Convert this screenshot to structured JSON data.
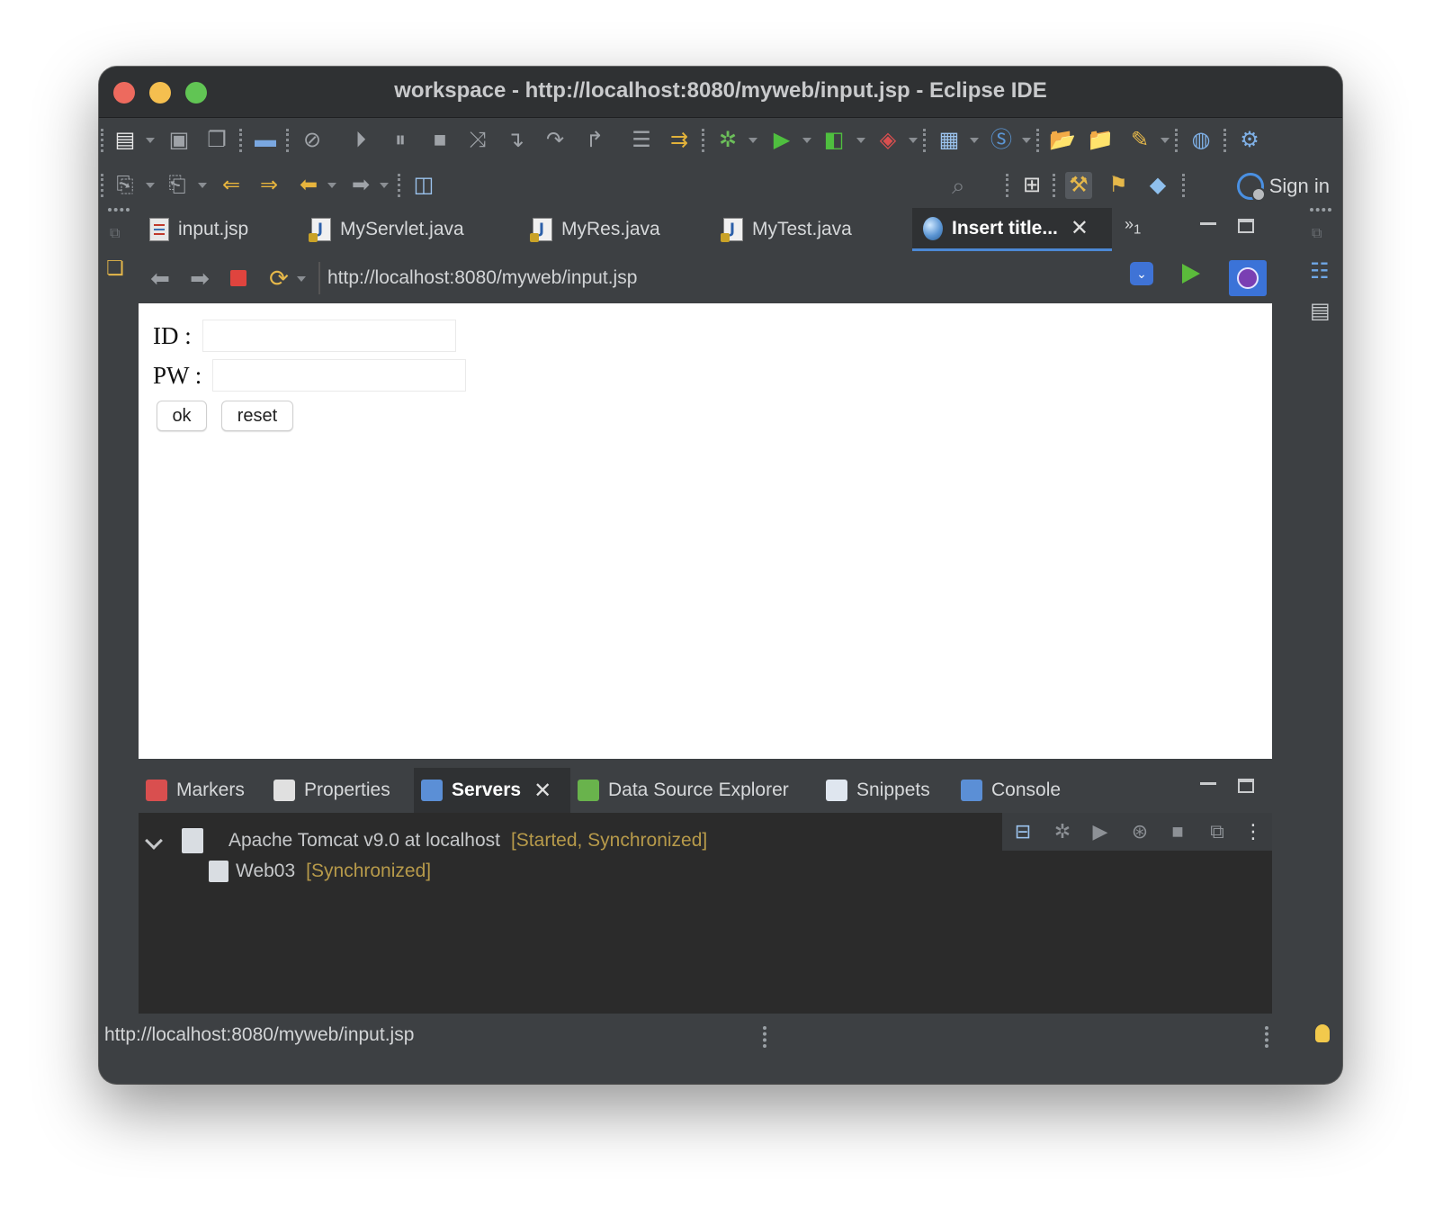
{
  "window": {
    "title": "workspace - http://localhost:8080/myweb/input.jsp - Eclipse IDE"
  },
  "toolbar": {
    "sign_in_label": "Sign in"
  },
  "editor_tabs": [
    {
      "label": "input.jsp",
      "icon": "jsp-file-icon"
    },
    {
      "label": "MyServlet.java",
      "icon": "java-file-icon"
    },
    {
      "label": "MyRes.java",
      "icon": "java-file-icon"
    },
    {
      "label": "MyTest.java",
      "icon": "java-file-icon"
    },
    {
      "label": "Insert title...",
      "icon": "globe-icon",
      "active": true
    }
  ],
  "overflow_tabs": {
    "label": "»",
    "count": "1"
  },
  "browser": {
    "url": "http://localhost:8080/myweb/input.jsp"
  },
  "form": {
    "id_label": "ID :",
    "pw_label": "PW :",
    "ok_label": "ok",
    "reset_label": "reset"
  },
  "bottom_tabs": [
    {
      "label": "Markers"
    },
    {
      "label": "Properties"
    },
    {
      "label": "Servers",
      "active": true
    },
    {
      "label": "Data Source Explorer"
    },
    {
      "label": "Snippets"
    },
    {
      "label": "Console"
    }
  ],
  "servers": {
    "server_name": "Apache Tomcat v9.0 at localhost",
    "server_status": "[Started, Synchronized]",
    "module_name": "Web03",
    "module_status": "[Synchronized]"
  },
  "statusbar": {
    "url": "http://localhost:8080/myweb/input.jsp"
  },
  "colors": {
    "active_tab_underline": "#4c88d4",
    "status_tag": "#b79a4a",
    "stop_red": "#e0443e",
    "run_green": "#5bbb3b"
  }
}
